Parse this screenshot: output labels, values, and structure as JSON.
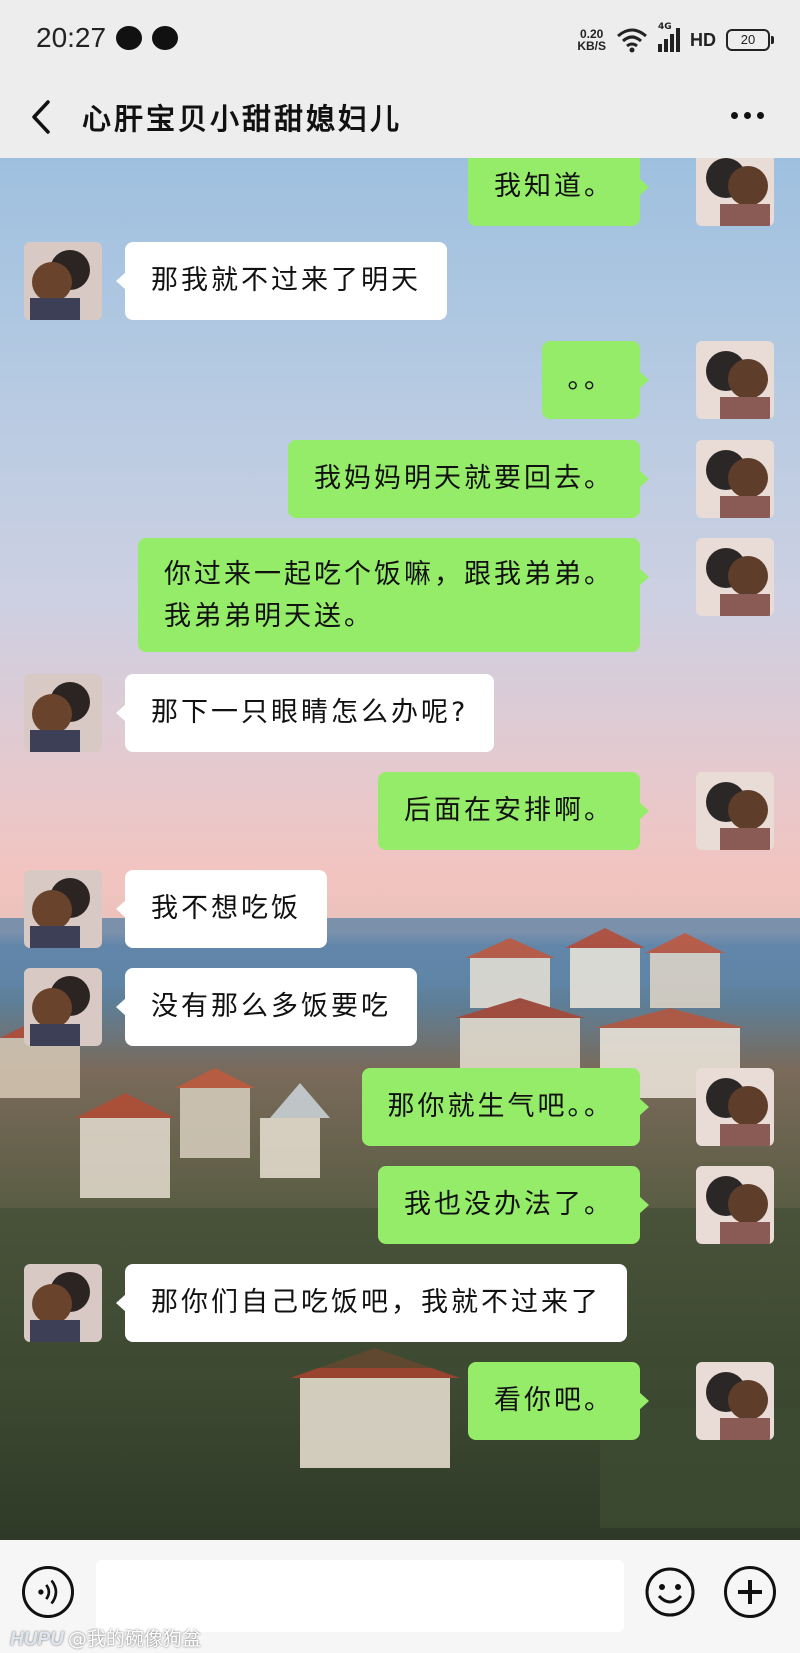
{
  "status": {
    "time": "20:27",
    "net_speed_value": "0.20",
    "net_speed_unit": "KB/S",
    "signal_label": "4G",
    "hd_label": "HD",
    "battery": "20"
  },
  "header": {
    "back_icon": "chevron-left-icon",
    "title": "心肝宝贝小甜甜媳妇儿",
    "more_icon": "more-icon"
  },
  "messages": [
    {
      "side": "me",
      "text": "我知道。"
    },
    {
      "side": "them",
      "text": "那我就不过来了明天"
    },
    {
      "side": "me",
      "text": "。。"
    },
    {
      "side": "me",
      "text": "我妈妈明天就要回去。"
    },
    {
      "side": "me",
      "text": "你过来一起吃个饭嘛，跟我弟弟。\n我弟弟明天送。"
    },
    {
      "side": "them",
      "text": "那下一只眼睛怎么办呢?"
    },
    {
      "side": "me",
      "text": "后面在安排啊。"
    },
    {
      "side": "them",
      "text": "我不想吃饭"
    },
    {
      "side": "them",
      "text": "没有那么多饭要吃"
    },
    {
      "side": "me",
      "text": "那你就生气吧。。"
    },
    {
      "side": "me",
      "text": "我也没办法了。"
    },
    {
      "side": "them",
      "text": "那你们自己吃饭吧，我就不过来了"
    },
    {
      "side": "me",
      "text": "看你吧。"
    }
  ],
  "input": {
    "voice_icon": "voice-icon",
    "text_value": "",
    "emoji_icon": "emoji-icon",
    "plus_icon": "plus-icon"
  },
  "watermark": {
    "brand": "HUPU",
    "handle": "@我的碗像狗盆"
  },
  "colors": {
    "my_bubble": "#95ec69",
    "their_bubble": "#ffffff",
    "bar_bg": "#ededed"
  }
}
